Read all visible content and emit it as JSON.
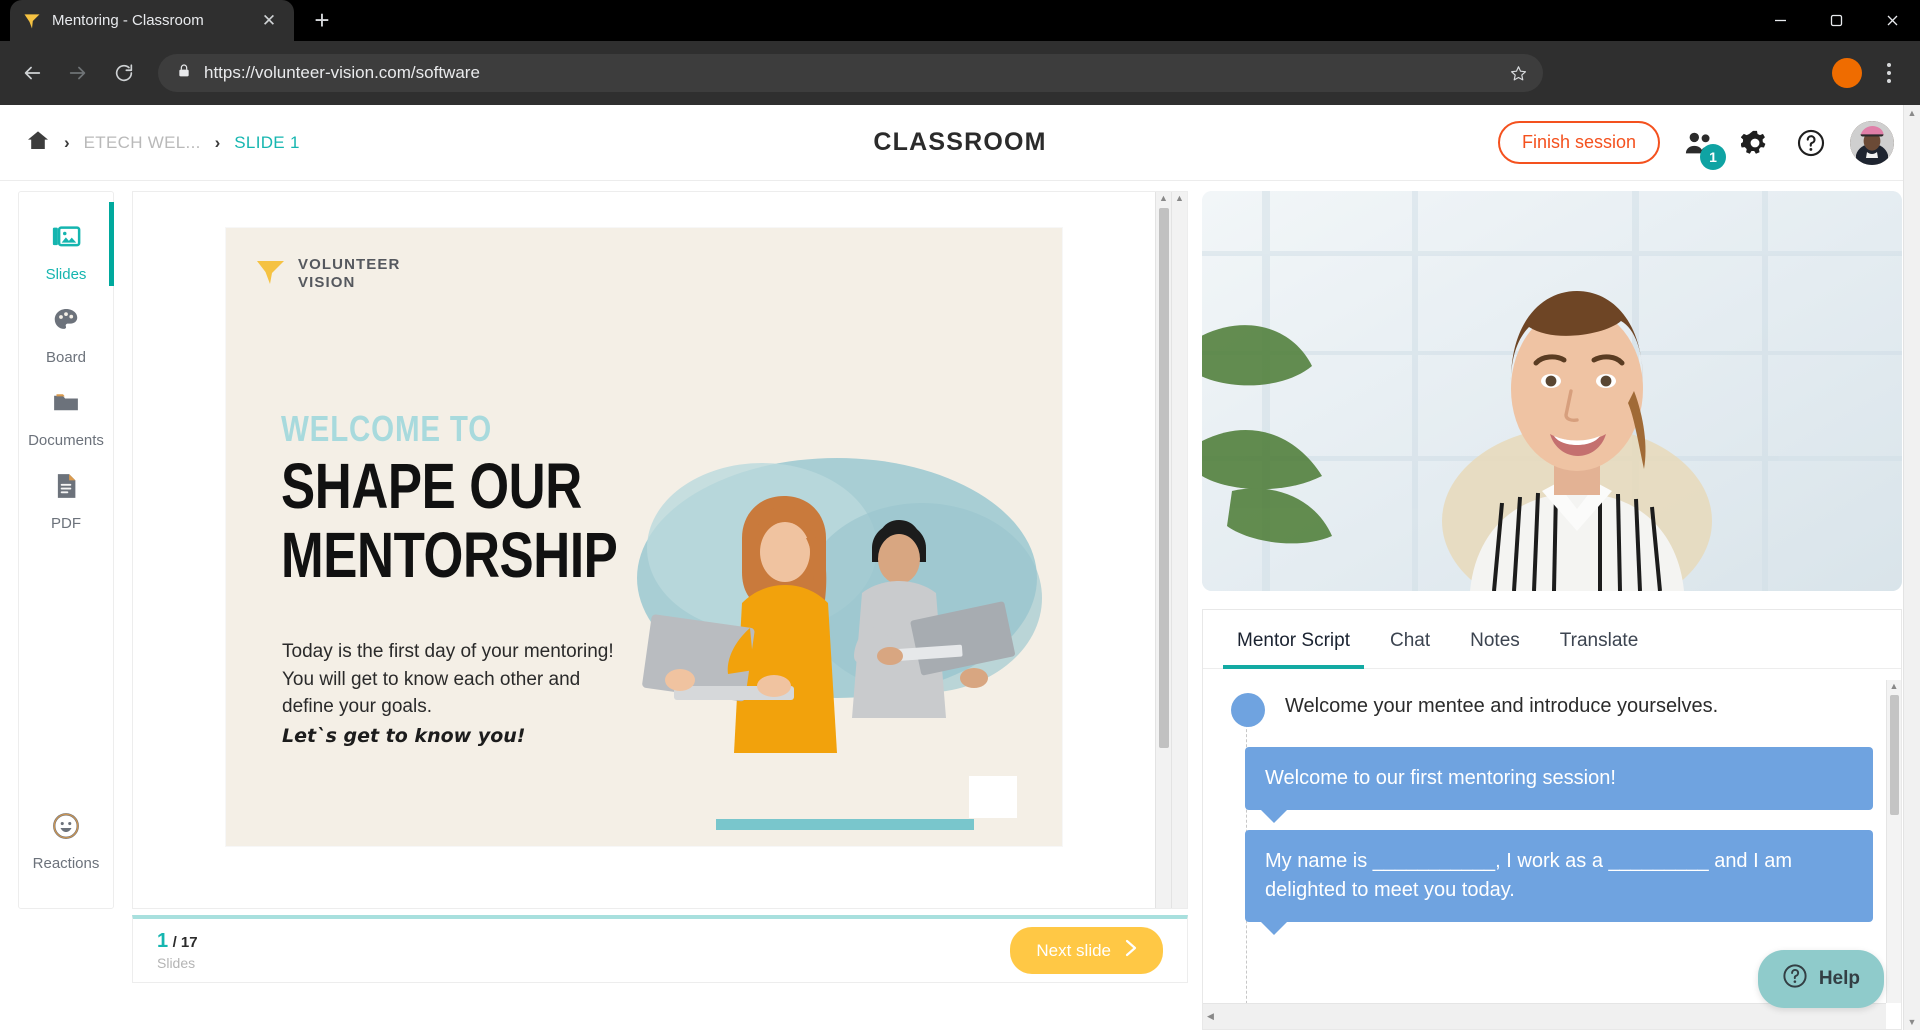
{
  "browser": {
    "tab": {
      "title": "Mentoring - Classroom",
      "favicon_icon": "volunteer-vision-logo-icon",
      "close_icon": "close-icon"
    },
    "new_tab_icon": "plus-icon",
    "window": {
      "minimize_icon": "minimize-icon",
      "maximize_icon": "maximize-icon",
      "close_icon": "window-close-icon"
    },
    "nav": {
      "back_icon": "back-arrow-icon",
      "forward_icon": "forward-arrow-icon",
      "reload_icon": "reload-icon"
    },
    "omnibox": {
      "lock_icon": "lock-icon",
      "url": "https://volunteer-vision.com/software",
      "star_icon": "bookmark-star-icon"
    },
    "profile_icon": "profile-avatar-icon",
    "menu_icon": "kebab-menu-icon"
  },
  "header": {
    "home_icon": "home-icon",
    "separator": "›",
    "breadcrumb_course": "ETECH WEL...",
    "breadcrumb_slide": "SLIDE 1",
    "title": "CLASSROOM",
    "finish_label": "Finish session",
    "participants_icon": "people-icon",
    "participants_count": "1",
    "settings_icon": "gear-icon",
    "help_icon": "question-circle-icon",
    "avatar_icon": "user-avatar"
  },
  "sidebar": {
    "items": [
      {
        "label": "Slides",
        "icon": "images-icon",
        "active": true
      },
      {
        "label": "Board",
        "icon": "palette-icon",
        "active": false
      },
      {
        "label": "Documents",
        "icon": "folder-icon",
        "active": false
      },
      {
        "label": "PDF",
        "icon": "pdf-file-icon",
        "active": false
      }
    ],
    "bottom_item": {
      "label": "Reactions",
      "icon": "smiley-face-icon"
    }
  },
  "slide": {
    "logo_line1": "VOLUNTEER",
    "logo_line2": "VISION",
    "logo_icon": "volunteer-vision-logo-icon",
    "eyebrow": "WELCOME TO",
    "heading": "SHAPE OUR\nMENTORSHIP",
    "body": "Today is the first day of your mentoring!\nYou will get to know each other and\ndefine your goals.",
    "handwritten": "Let`s get to know you!",
    "artwork_icon": "two-people-with-laptops-illustration"
  },
  "footer": {
    "current": "1",
    "total": "/ 17",
    "caption": "Slides",
    "next_label": "Next slide",
    "next_icon": "chevron-right-icon"
  },
  "video": {
    "feed_icon": "mentor-webcam-video"
  },
  "panel": {
    "tabs": [
      {
        "label": "Mentor Script",
        "active": true
      },
      {
        "label": "Chat",
        "active": false
      },
      {
        "label": "Notes",
        "active": false
      },
      {
        "label": "Translate",
        "active": false
      }
    ],
    "instruction": "Welcome your mentee and introduce yourselves.",
    "bubbles": [
      "Welcome to our first mentoring session!",
      "My name is ___________,  I work as a _________ and I am delighted to meet you today."
    ]
  },
  "help_widget": {
    "label": "Help",
    "icon": "question-circle-icon"
  },
  "colors": {
    "teal": "#15b5af",
    "teal_dark": "#00a99d",
    "orange": "#f4511e",
    "yellow": "#ffc845",
    "bubble_blue": "#6fa3e0",
    "slide_bg": "#f4efe6",
    "help_teal": "#8fcbcb"
  }
}
